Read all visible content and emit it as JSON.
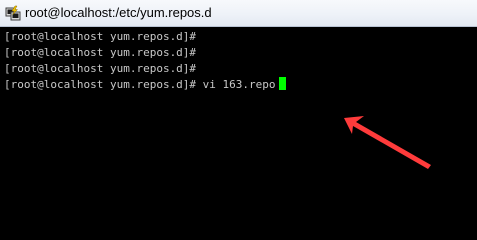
{
  "window": {
    "title": "root@localhost:/etc/yum.repos.d",
    "icon": "putty-terminal-icon"
  },
  "terminal": {
    "lines": [
      "[root@localhost yum.repos.d]#",
      "[root@localhost yum.repos.d]#",
      "[root@localhost yum.repos.d]#",
      "[root@localhost yum.repos.d]# vi 163.repo"
    ],
    "text_color": "#c8c8c8",
    "background": "#000000",
    "cursor_color": "#00ff00"
  },
  "annotation": {
    "type": "arrow",
    "color": "#ff3b3b",
    "points_to": "terminal-cursor"
  }
}
